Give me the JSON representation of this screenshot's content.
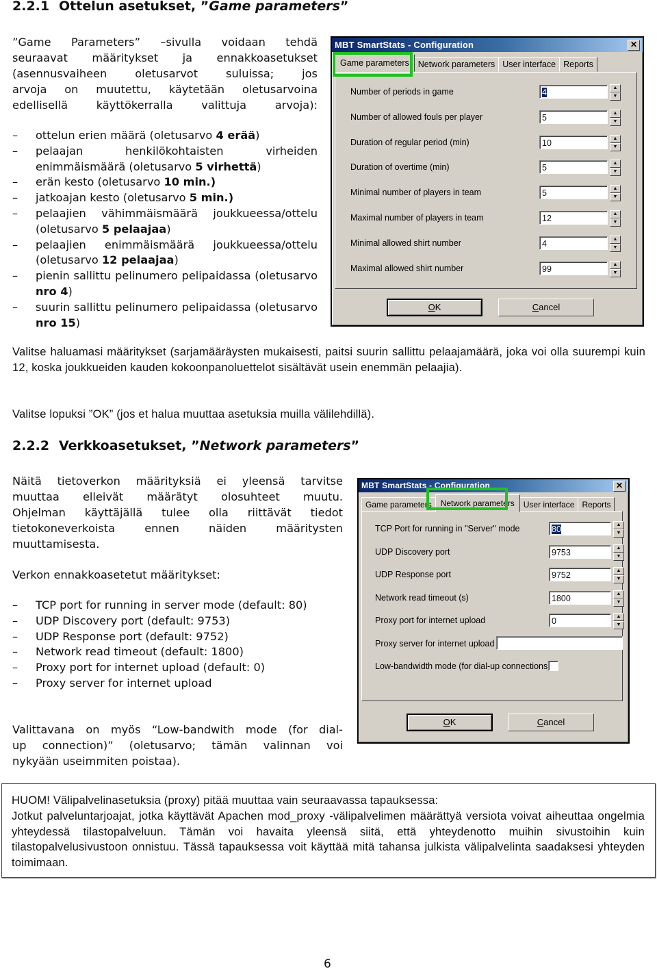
{
  "section1": {
    "number": "2.2.1",
    "title_prefix": "Ottelun asetukset, ”",
    "title_italic": "Game parameters",
    "title_suffix": "”",
    "intro_lines": [
      "”Game Parameters” –sivulla voidaan tehdä",
      "seuraavat määritykset ja ennakkoasetukset",
      "(asennusvaiheen oletusarvot suluissa; jos",
      "arvoja on muutettu, käytetään oletusarvoina",
      "edellisellä käyttökerralla valittuja arvoja):"
    ],
    "list": [
      {
        "text": "ottelun erien määrä (oletusarvo ",
        "bold": "4 erää",
        "after": ")"
      },
      {
        "text": "pelaajan henkilökohtaisten virheiden enimmäismäärä (oletusarvo ",
        "bold": "5 virhettä",
        "after": ")"
      },
      {
        "text": "erän kesto (oletusarvo ",
        "bold": "10 min.)",
        "after": ""
      },
      {
        "text": "jatkoajan kesto (oletusarvo ",
        "bold": "5 min.)",
        "after": ""
      },
      {
        "text": "pelaajien vähimmäismäärä joukkueessa/ottelu (oletusarvo ",
        "bold": "5 pelaajaa",
        "after": ")"
      },
      {
        "text": "pelaajien enimmäismäärä joukkueessa/ottelu (oletusarvo ",
        "bold": "12 pelaajaa",
        "after": ")"
      },
      {
        "text": "pienin sallittu pelinumero pelipaidassa (oletusarvo ",
        "bold": "nro 4",
        "after": ")"
      },
      {
        "text": "suurin sallittu pelinumero pelipaidassa (oletusarvo ",
        "bold": "nro 15",
        "after": ")"
      }
    ],
    "para1": "Valitse haluamasi määritykset (sarjamääräysten mukaisesti, paitsi suurin sallittu pelaajamäärä, joka voi olla suurempi kuin 12, koska joukkueiden kauden kokoonpanoluettelot sisältävät usein enemmän pelaajia).",
    "para2": "Valitse lopuksi ”OK” (jos et halua muuttaa asetuksia muilla välilehdillä)."
  },
  "dialog1": {
    "title": "MBT SmartStats - Configuration",
    "close_glyph": "✕",
    "tabs": [
      "Game parameters",
      "Network parameters",
      "User interface",
      "Reports"
    ],
    "active_tab": "Game parameters",
    "fields": [
      {
        "label": "Number of periods in game",
        "value": "4",
        "selected": true
      },
      {
        "label": "Number of allowed fouls per player",
        "value": "5"
      },
      {
        "label": "Duration of regular period (min)",
        "value": "10"
      },
      {
        "label": "Duration of overtime (min)",
        "value": "5"
      },
      {
        "label": "Minimal number of players in team",
        "value": "5"
      },
      {
        "label": "Maximal number of players in team",
        "value": "12"
      },
      {
        "label": "Minimal allowed shirt number",
        "value": "4"
      },
      {
        "label": "Maximal allowed shirt number",
        "value": "99"
      }
    ],
    "ok_hotkey": "O",
    "ok_rest": "K",
    "cancel_hotkey": "C",
    "cancel_rest": "ancel",
    "spin_up": "▲",
    "spin_down": "▼",
    "highlight_color": "#22c022"
  },
  "section2": {
    "number": "2.2.2",
    "title_prefix": "Verkkoasetukset, ”",
    "title_italic": "Network parameters",
    "title_suffix": "”",
    "intro_lines": [
      "Näitä tietoverkon määrityksiä ei yleensä tarvitse",
      "muuttaa elleivät määrätyt olosuhteet muutu.",
      "Ohjelman käyttäjällä tulee olla riittävät tiedot",
      "tietokoneverkoista ennen näiden määritysten",
      "muuttamisesta."
    ],
    "defaults_heading": "Verkon ennakkoasetetut määritykset:",
    "list": [
      "TCP port for running in server mode (default: 80)",
      "UDP Discovery port (default: 9753)",
      "UDP Response port (default: 9752)",
      "Network read timeout (default: 1800)",
      "Proxy port for internet upload (default: 0)",
      "Proxy server for internet upload"
    ],
    "closing_lines": [
      "Valittavana on myös “Low-bandwith mode (for dial-",
      "up connection)” (oletusarvo; tämän valinnan voi",
      "nykyään useimmiten poistaa)."
    ]
  },
  "dialog2": {
    "title": "MBT SmartStats - Configuration",
    "close_glyph": "✕",
    "tabs": [
      "Game parameters",
      "Network parameters",
      "User interface",
      "Reports"
    ],
    "active_tab": "Network parameters",
    "fields": [
      {
        "label": "TCP Port for running in \"Server\" mode",
        "value": "80",
        "selected": true
      },
      {
        "label": "UDP Discovery port",
        "value": "9753"
      },
      {
        "label": "UDP Response port",
        "value": "9752"
      },
      {
        "label": "Network read timeout (s)",
        "value": "1800"
      },
      {
        "label": "Proxy port for internet upload",
        "value": "0"
      }
    ],
    "proxy_server_label": "Proxy server for internet upload",
    "proxy_server_value": "",
    "lowbw_label": "Low-bandwidth mode (for dial-up connections)",
    "lowbw_checked": false,
    "ok_hotkey": "O",
    "ok_rest": "K",
    "cancel_hotkey": "C",
    "cancel_rest": "ancel",
    "spin_up": "▲",
    "spin_down": "▼"
  },
  "note": {
    "line1": "HUOM! Välipalvelinasetuksia (proxy) pitää muuttaa vain seuraavassa tapauksessa:",
    "body": "Jotkut palveluntarjoajat, jotka käyttävät Apachen mod_proxy -välipalvelimen määrättyä versiota voivat aiheuttaa ongelmia yhteydessä tilastopalveluun. Tämän voi havaita yleensä siitä, että yhteydenotto muihin sivustoihin kuin tilastopalvelusivustoon onnistuu. Tässä tapauksessa voit käyttää mitä tahansa julkista välipalvelinta saadaksesi yhteyden toimimaan."
  },
  "page_number": "6"
}
